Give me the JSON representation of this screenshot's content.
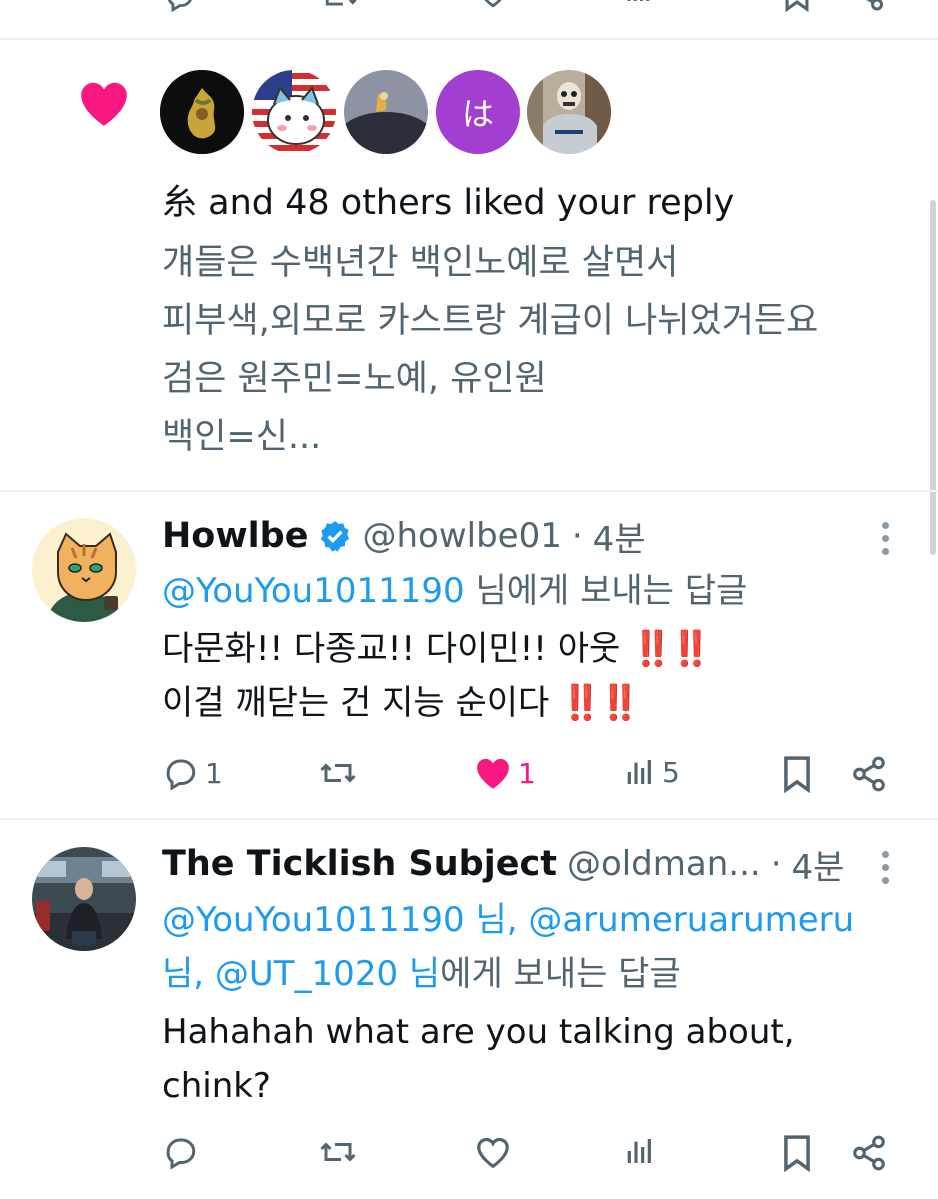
{
  "notification": {
    "avatars": [
      "avatar-1",
      "avatar-2",
      "avatar-3",
      "は",
      "avatar-5"
    ],
    "summary_symbol": "糸",
    "summary": "and 48 others liked your reply",
    "quoted_lines": [
      "걔들은 수백년간 백인노예로 살면서",
      "피부색,외모로 카스트랑 계급이 나뉘었거든요",
      "검은 원주민=노예, 유인원",
      "백인=신..."
    ]
  },
  "posts": [
    {
      "display_name": "Howlbe",
      "verified": true,
      "handle": "@howlbe01",
      "separator": "·",
      "time": "4분",
      "reply_to_mention": "@YouYou1011190",
      "reply_to_suffix": "님에게 보내는 답글",
      "line1": "다문화!! 다종교!! 다이민!! 아웃",
      "line1_emoji": "‼️‼️",
      "line2": "이걸 깨닫는 건 지능 순이다",
      "line2_emoji": "‼️‼️",
      "replies": "1",
      "retweets": "",
      "likes": "1",
      "views": "5"
    },
    {
      "display_name": "The Ticklish Subject",
      "handle": "@oldman...",
      "separator": "·",
      "time": "4분",
      "reply_line1_mention": "@YouYou1011190 님, @arumeruarumeru",
      "reply_line2_mention": "님, @UT_1020 님",
      "reply_to_suffix": "에게 보내는 답글",
      "line1": "Hahahah what are you talking about,",
      "line2": "chink?",
      "replies": "",
      "retweets": "",
      "likes": "",
      "views": ""
    }
  ],
  "colors": {
    "accent": "#1d9bf0",
    "like": "#f91880",
    "muted": "#536471",
    "divider": "#eff3f4"
  }
}
